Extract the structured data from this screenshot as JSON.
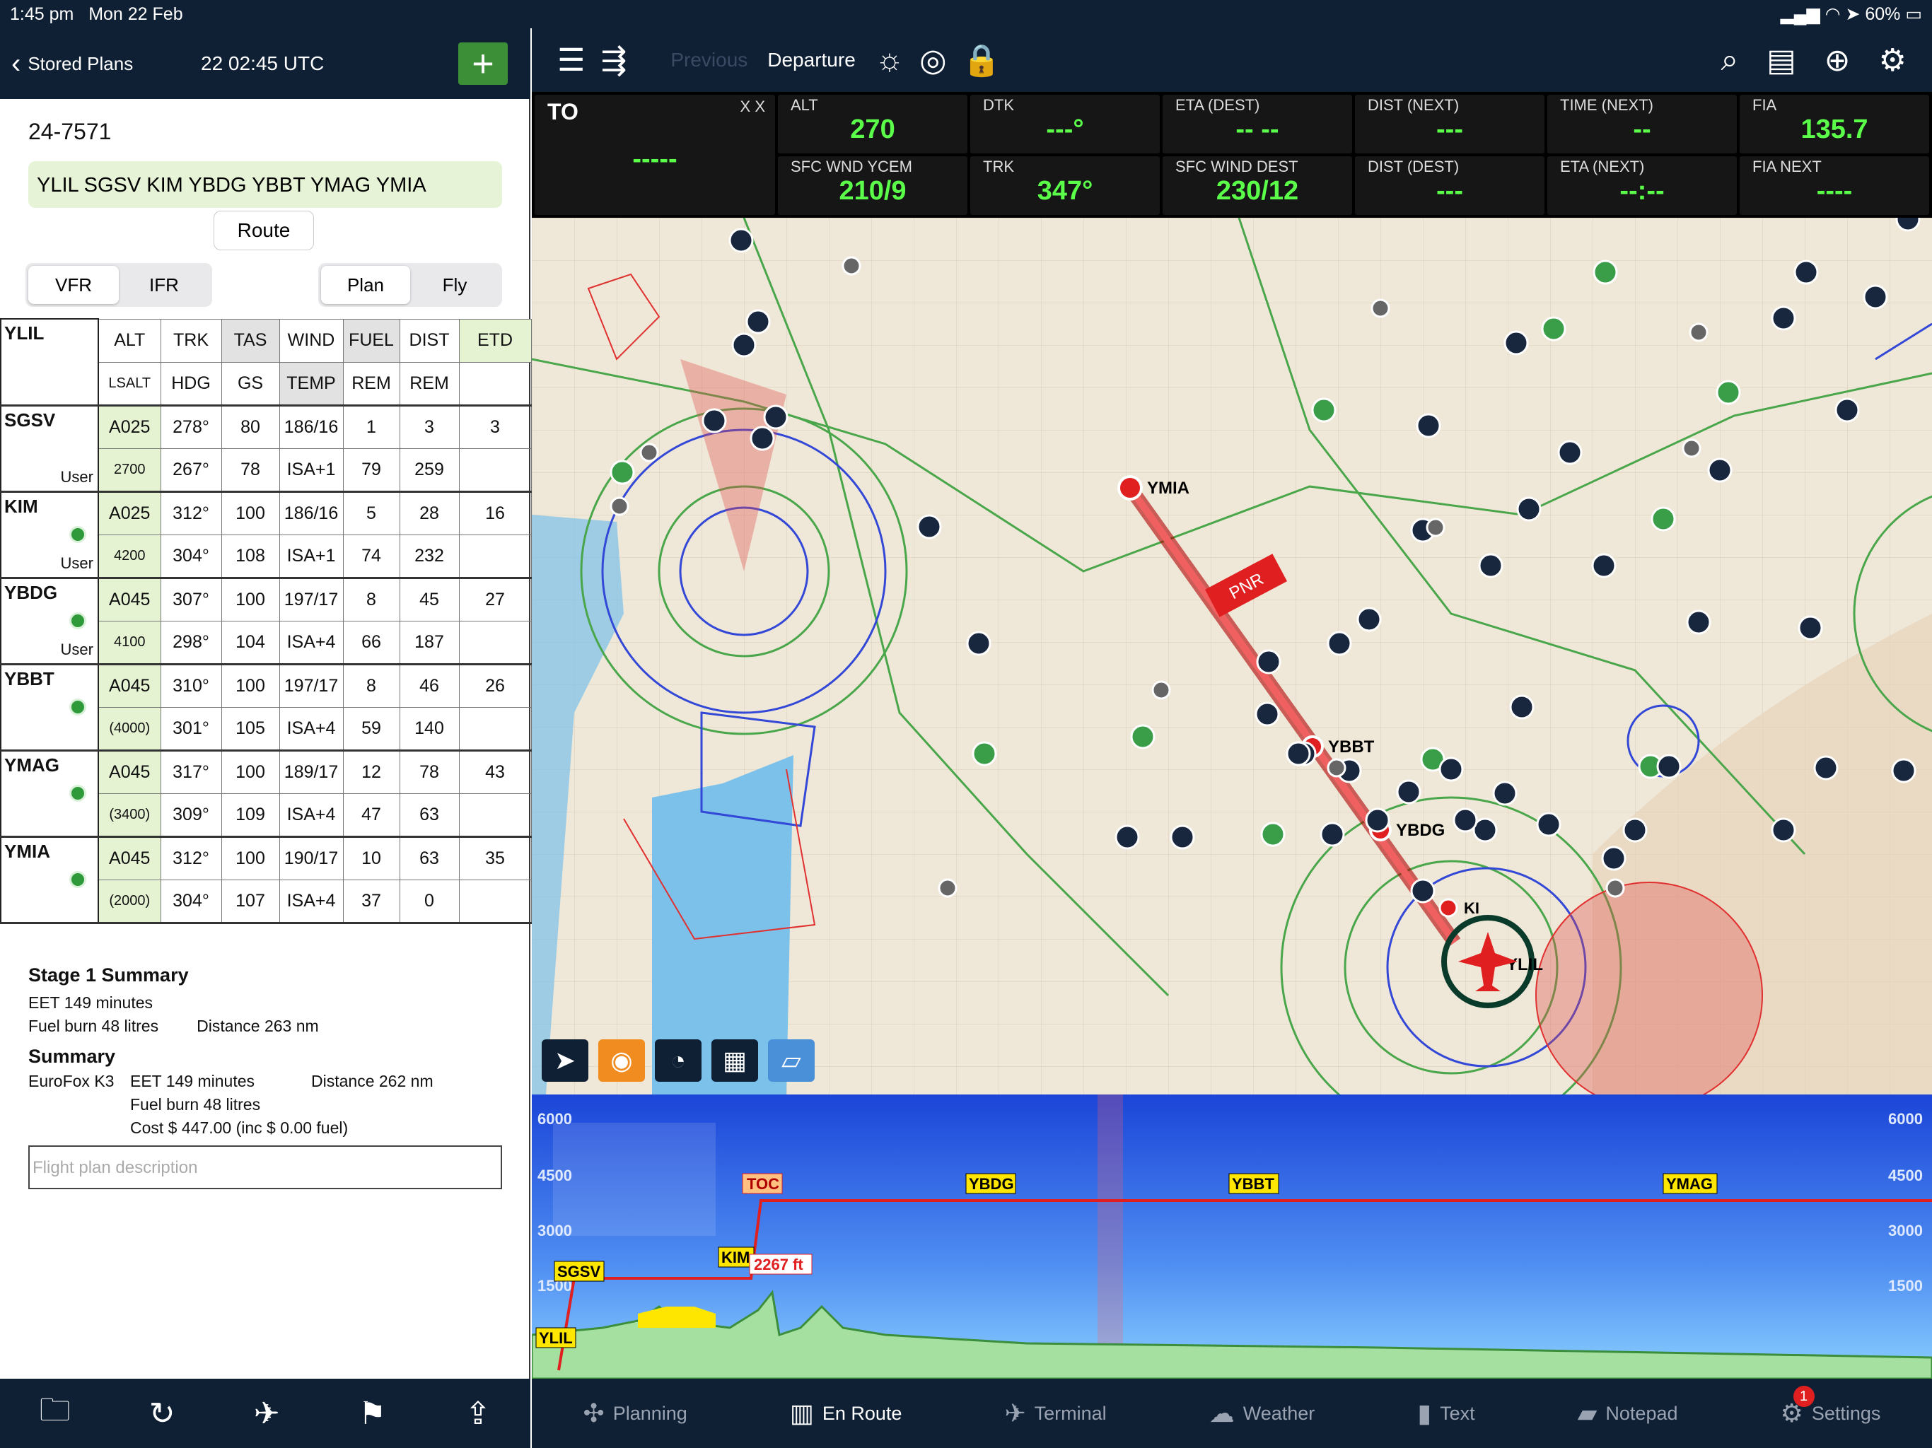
{
  "status": {
    "time": "1:45 pm",
    "date": "Mon 22 Feb",
    "battery": "60%"
  },
  "left": {
    "back_label": "Stored Plans",
    "utc": "22 02:45 UTC",
    "add_label": "+",
    "plan_id": "24-7571",
    "route": "YLIL SGSV KIM YBDG YBBT YMAG YMIA",
    "route_button": "Route",
    "rule_tabs": [
      "VFR",
      "IFR"
    ],
    "mode_tabs": [
      "Plan",
      "Fly"
    ],
    "start_wp": "YLIL",
    "headers_top": [
      "ALT",
      "TRK",
      "TAS",
      "WIND",
      "FUEL",
      "DIST",
      "ETD"
    ],
    "headers_bottom": [
      "LSALT",
      "HDG",
      "GS",
      "TEMP",
      "REM",
      "REM",
      ""
    ],
    "rows": [
      {
        "wp": "SGSV",
        "tag": "User",
        "alt": "A025",
        "trk": "278°",
        "tas": "80",
        "wind": "186/16",
        "fuel": "1",
        "dist": "3",
        "etd": "3",
        "lsalt": "2700",
        "hdg": "267°",
        "gs": "78",
        "temp": "ISA+1",
        "frem": "79",
        "drem": "259"
      },
      {
        "wp": "KIM",
        "tag": "User",
        "alt": "A025",
        "trk": "312°",
        "tas": "100",
        "wind": "186/16",
        "fuel": "5",
        "dist": "28",
        "etd": "16",
        "lsalt": "4200",
        "hdg": "304°",
        "gs": "108",
        "temp": "ISA+1",
        "frem": "74",
        "drem": "232"
      },
      {
        "wp": "YBDG",
        "tag": "User",
        "alt": "A045",
        "trk": "307°",
        "tas": "100",
        "wind": "197/17",
        "fuel": "8",
        "dist": "45",
        "etd": "27",
        "lsalt": "4100",
        "hdg": "298°",
        "gs": "104",
        "temp": "ISA+4",
        "frem": "66",
        "drem": "187"
      },
      {
        "wp": "YBBT",
        "tag": "",
        "alt": "A045",
        "trk": "310°",
        "tas": "100",
        "wind": "197/17",
        "fuel": "8",
        "dist": "46",
        "etd": "26",
        "lsalt": "(4000)",
        "hdg": "301°",
        "gs": "105",
        "temp": "ISA+4",
        "frem": "59",
        "drem": "140"
      },
      {
        "wp": "YMAG",
        "tag": "",
        "alt": "A045",
        "trk": "317°",
        "tas": "100",
        "wind": "189/17",
        "fuel": "12",
        "dist": "78",
        "etd": "43",
        "lsalt": "(3400)",
        "hdg": "309°",
        "gs": "109",
        "temp": "ISA+4",
        "frem": "47",
        "drem": "63"
      },
      {
        "wp": "YMIA",
        "tag": "",
        "alt": "A045",
        "trk": "312°",
        "tas": "100",
        "wind": "190/17",
        "fuel": "10",
        "dist": "63",
        "etd": "35",
        "lsalt": "(2000)",
        "hdg": "304°",
        "gs": "107",
        "temp": "ISA+4",
        "frem": "37",
        "drem": "0"
      }
    ],
    "stage_title": "Stage 1 Summary",
    "stage_eet": "EET 149 minutes",
    "stage_fuel": "Fuel burn 48 litres",
    "stage_dist": "Distance 263 nm",
    "summary_title": "Summary",
    "aircraft": "EuroFox K3",
    "sum_eet": "EET 149 minutes",
    "sum_dist": "Distance 262 nm",
    "sum_fuel": "Fuel burn 48 litres",
    "sum_cost": "Cost $ 447.00 (inc $ 0.00 fuel)",
    "desc_placeholder": "Flight plan description"
  },
  "right": {
    "prev": "Previous",
    "title": "Departure",
    "instr": [
      {
        "label": "TO",
        "value": "-----"
      },
      {
        "label": "ALT",
        "value": "270"
      },
      {
        "label": "DTK",
        "value": "---°"
      },
      {
        "label": "ETA (DEST)",
        "value": "-- --"
      },
      {
        "label": "DIST (NEXT)",
        "value": "---"
      },
      {
        "label": "TIME (NEXT)",
        "value": "--"
      },
      {
        "label": "FIA",
        "value": "135.7"
      },
      {
        "label": "SFC WND YCEM",
        "value": "210/9"
      },
      {
        "label": "TRK",
        "value": "347°"
      },
      {
        "label": "SFC WIND DEST",
        "value": "230/12"
      },
      {
        "label": "DIST (DEST)",
        "value": "---"
      },
      {
        "label": "ETA (NEXT)",
        "value": "--:--"
      },
      {
        "label": "FIA NEXT",
        "value": "----"
      }
    ],
    "xx": "X X",
    "map_labels": {
      "ymia": "YMIA",
      "ybbt": "YBBT",
      "ybdg": "YBDG",
      "ylil": "YLIL",
      "kim": "KI",
      "pnr": "PNR"
    },
    "profile": {
      "alt_labels": [
        "6000",
        "4500",
        "3000",
        "1500"
      ],
      "toc": "TOC",
      "wps": [
        "YBDG",
        "YBBT",
        "YMAG"
      ],
      "sgsv": "SGSV",
      "kim": "KIM",
      "ylil": "YLIL",
      "terrain_label": "2267 ft"
    },
    "tabs": [
      {
        "label": "Planning"
      },
      {
        "label": "En Route"
      },
      {
        "label": "Terminal"
      },
      {
        "label": "Weather"
      },
      {
        "label": "Text"
      },
      {
        "label": "Notepad"
      },
      {
        "label": "Settings",
        "badge": "1"
      }
    ]
  }
}
